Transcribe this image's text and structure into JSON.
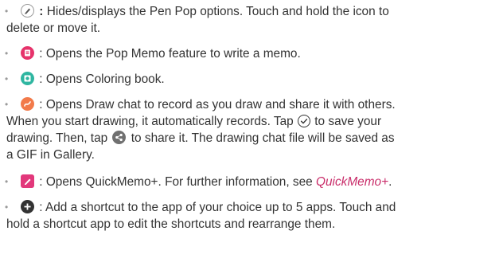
{
  "items": [
    {
      "lead": ":",
      "text1": " Hides/displays the Pen Pop options. Touch and hold the icon to",
      "text2": "delete or move it."
    },
    {
      "lead": " : ",
      "text1": "Opens the Pop Memo feature to write a memo."
    },
    {
      "lead": " : ",
      "text1": "Opens Coloring book."
    },
    {
      "lead": " : ",
      "text1": "Opens Draw chat to record as you draw and share it with others.",
      "text2a": "When you start drawing, it automatically records. Tap ",
      "text2b": " to save your",
      "text3a": "drawing. Then, tap ",
      "text3b": " to share it. The drawing chat file will be saved as",
      "text4": "a GIF in Gallery."
    },
    {
      "lead": " : ",
      "text1": "Opens QuickMemo+. For further information, see ",
      "link": "QuickMemo+",
      "tail": "."
    },
    {
      "lead": " : ",
      "text1": "Add a shortcut to the app of your choice up to 5 apps. Touch and",
      "text2": "hold a shortcut app to edit the shortcuts and rearrange them."
    }
  ],
  "icons": {
    "pen": "pen-pop-icon",
    "popmemo": "pop-memo-icon",
    "coloring": "coloring-book-icon",
    "drawchat": "draw-chat-icon",
    "check": "check-circle-icon",
    "share": "share-icon",
    "quickmemo": "quickmemo-icon",
    "add": "add-shortcut-icon"
  },
  "colors": {
    "text": "#333333",
    "link": "#c92d6a",
    "popmemo": "#e6336b",
    "coloring": "#2fb6a1",
    "drawchat": "#f27a4a",
    "quickmemo": "#e2387b",
    "add": "#333333"
  }
}
